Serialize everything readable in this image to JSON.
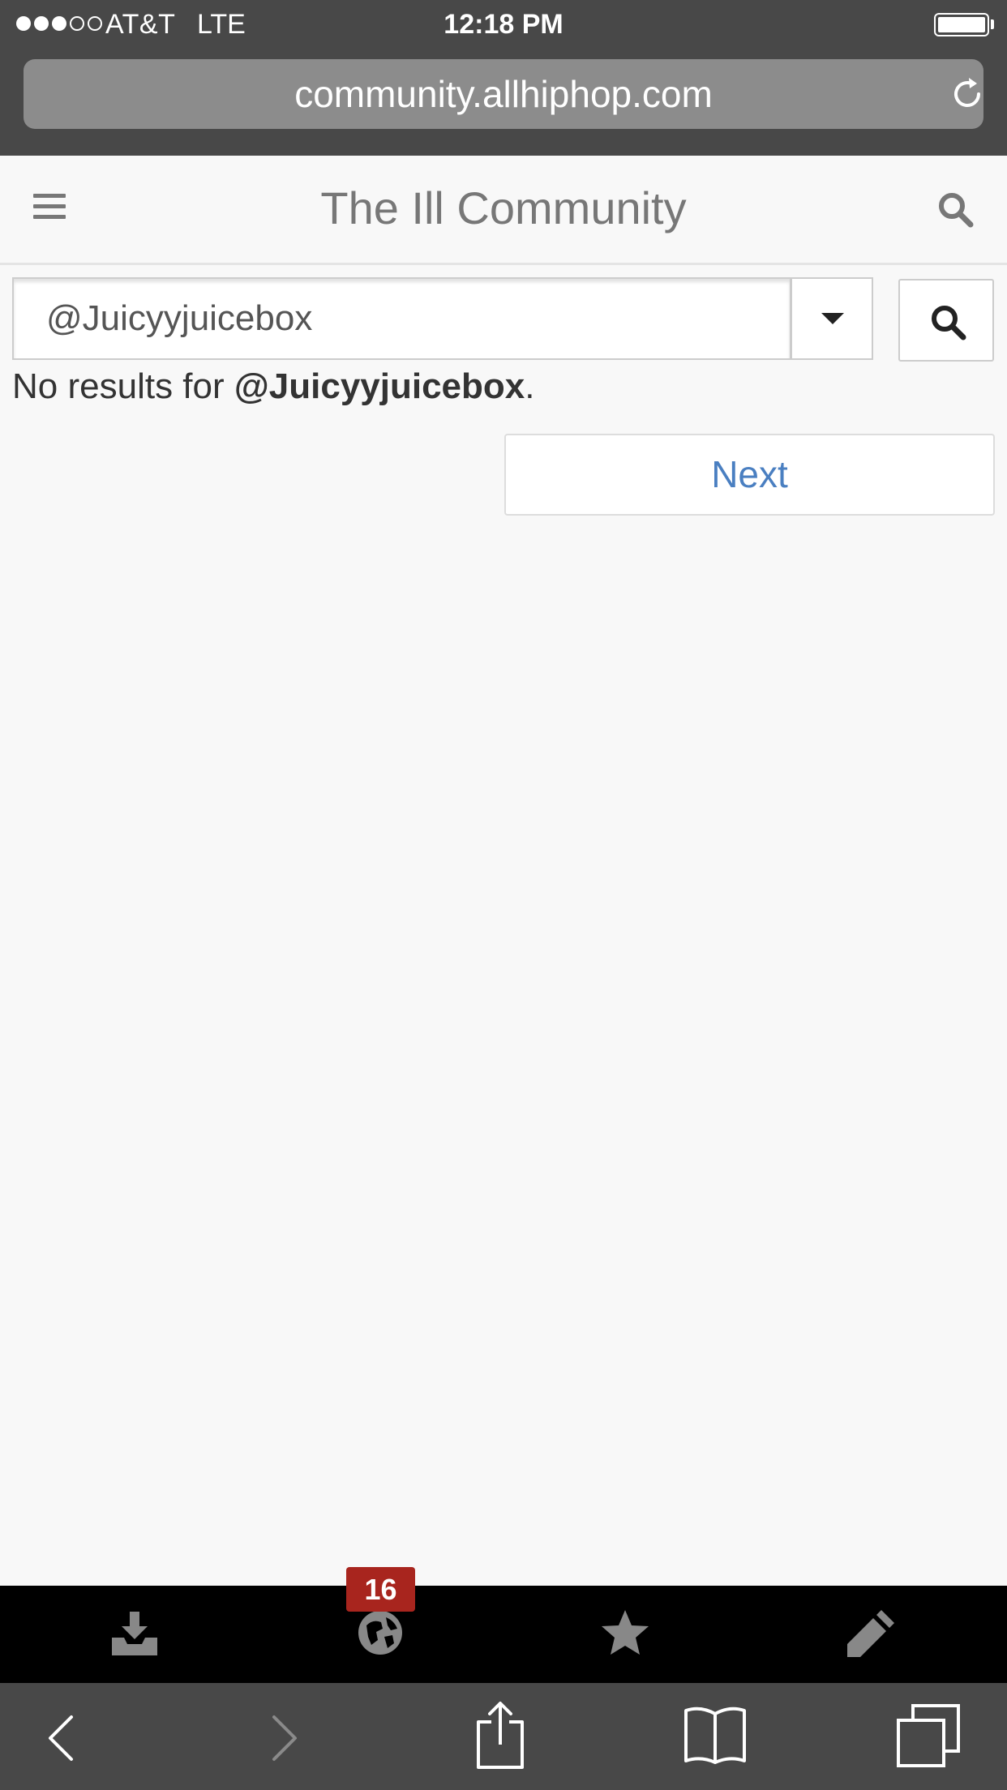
{
  "status_bar": {
    "carrier": "AT&T",
    "network": "LTE",
    "time": "12:18 PM",
    "signal_bars_filled": 3,
    "signal_bars_total": 5,
    "battery_level": 1.0
  },
  "browser": {
    "url": "community.allhiphop.com",
    "icons": {
      "reload": "reload-icon",
      "back": "back-chevron-icon",
      "forward": "forward-chevron-icon",
      "share": "share-icon",
      "bookmarks": "open-book-icon",
      "tabs": "tabs-icon"
    }
  },
  "header": {
    "title": "The Ill Community",
    "icons": {
      "menu": "hamburger-menu-icon",
      "search": "search-icon"
    }
  },
  "search": {
    "value": "@Juicyyjuicebox",
    "icons": {
      "dropdown": "caret-down-icon",
      "submit": "search-icon"
    }
  },
  "results": {
    "no_results_prefix": "No results for ",
    "query": "@Juicyyjuicebox",
    "no_results_suffix": "."
  },
  "pagination": {
    "next_label": "Next"
  },
  "app_toolbar": {
    "notification_count": "16",
    "icons": [
      "inbox-download-icon",
      "globe-icon",
      "star-icon",
      "pencil-icon"
    ]
  },
  "colors": {
    "browser_chrome": "#484848",
    "url_field": "#8c8c8c",
    "page_background": "#f8f8f8",
    "title_text": "#777777",
    "link_blue": "#4a7fc1",
    "badge_red": "#a8251e",
    "toolbar_background": "#000000",
    "toolbar_icon": "#888888"
  }
}
